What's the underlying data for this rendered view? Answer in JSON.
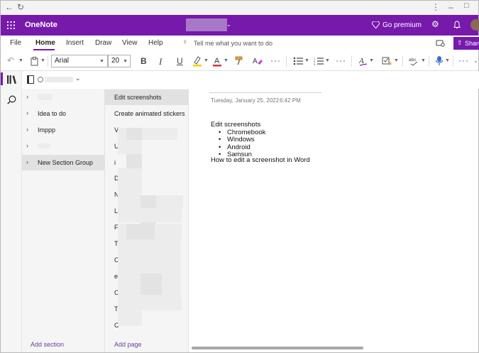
{
  "window": {
    "minimize_glyph": "–",
    "maximize_glyph": "□",
    "close_glyph": "✕",
    "menu_glyph": "⋮"
  },
  "app": {
    "title": "OneNote",
    "premium_label": "Go premium",
    "share_label": "Share"
  },
  "ribbon": {
    "tabs": [
      "File",
      "Home",
      "Insert",
      "Draw",
      "View",
      "Help"
    ],
    "active_tab": "Home",
    "tell_me_placeholder": "Tell me what you want to do",
    "font_name": "Arial",
    "font_size": "20",
    "bold": "B",
    "italic": "I",
    "underline": "U",
    "more": "···",
    "accent_color": "#7719aa",
    "highlight_color": "#f5d000",
    "font_color_bar": "#d13438"
  },
  "sections": {
    "items": [
      {
        "label": ""
      },
      {
        "label": "Idea to do"
      },
      {
        "label": "Imppp"
      },
      {
        "label": ""
      },
      {
        "label": "New Section Group"
      }
    ],
    "selected_index": 4,
    "add_label": "Add section"
  },
  "pages": {
    "items": [
      {
        "label": "Edit screenshots"
      },
      {
        "label": "Create animated stickers"
      },
      {
        "label": "V"
      },
      {
        "label": "U"
      },
      {
        "label": "i"
      },
      {
        "label": "D"
      },
      {
        "label": "N"
      },
      {
        "label": "L"
      },
      {
        "label": "F"
      },
      {
        "label": "T"
      },
      {
        "label": "C"
      },
      {
        "label": "e"
      },
      {
        "label": "C"
      },
      {
        "label": "T"
      },
      {
        "label": "C"
      }
    ],
    "selected_index": 0,
    "add_label": "Add page"
  },
  "note": {
    "date": "Tuesday, January 25, 2022",
    "time": "6:42 PM",
    "heading": "Edit screenshots",
    "bullets": [
      "Chromebook",
      "Windows",
      "Android",
      "Samsun"
    ],
    "footer": "How to edit a screenshot in Word"
  }
}
